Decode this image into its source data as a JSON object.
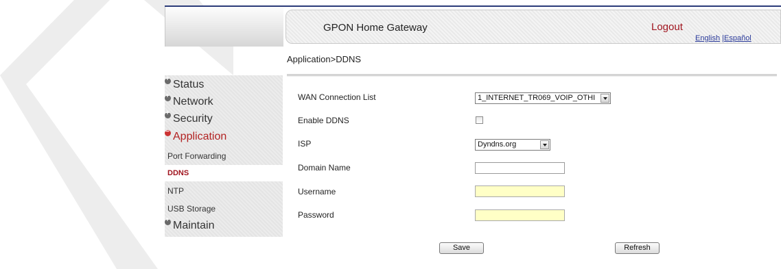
{
  "header": {
    "title": "GPON Home Gateway",
    "logout": "Logout",
    "lang_english": "English",
    "lang_sep": "|",
    "lang_spanish": "Español"
  },
  "breadcrumb": "Application>DDNS",
  "sidebar": {
    "top_items": [
      "Status",
      "Network",
      "Security",
      "Application",
      "Maintain"
    ],
    "active_item": "Application",
    "sub_items": [
      "Port Forwarding",
      "DDNS",
      "NTP",
      "USB Storage"
    ],
    "selected_sub_item": "DDNS"
  },
  "form": {
    "wan_label": "WAN Connection List",
    "wan_value": "1_INTERNET_TR069_VOIP_OTHI",
    "enable_label": "Enable DDNS",
    "enable_checked": false,
    "isp_label": "ISP",
    "isp_value": "Dyndns.org",
    "domain_label": "Domain Name",
    "domain_value": "",
    "username_label": "Username",
    "username_value": "",
    "password_label": "Password",
    "password_value": ""
  },
  "buttons": {
    "save": "Save",
    "refresh": "Refresh"
  },
  "colors": {
    "accent": "#a0141e",
    "link": "#2a3a9a",
    "autofill": "#ffffc6"
  }
}
